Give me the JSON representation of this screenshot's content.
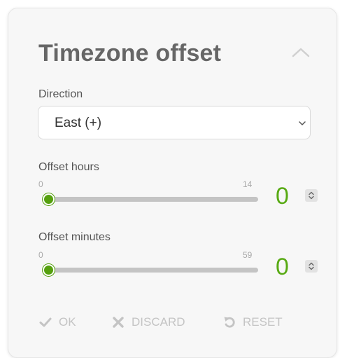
{
  "panel": {
    "title": "Timezone offset",
    "collapse_icon": "chevron-up-icon"
  },
  "direction": {
    "label": "Direction",
    "selected": "East (+)"
  },
  "offset_hours": {
    "label": "Offset hours",
    "min_label": "0",
    "max_label": "14",
    "value": "0",
    "min": 0,
    "max": 14
  },
  "offset_minutes": {
    "label": "Offset minutes",
    "min_label": "0",
    "max_label": "59",
    "value": "0",
    "min": 0,
    "max": 59
  },
  "actions": {
    "ok_label": "OK",
    "discard_label": "DISCARD",
    "reset_label": "RESET",
    "disabled_color": "#c4c4c4"
  },
  "colors": {
    "accent": "#58aa14",
    "title": "#666666"
  }
}
